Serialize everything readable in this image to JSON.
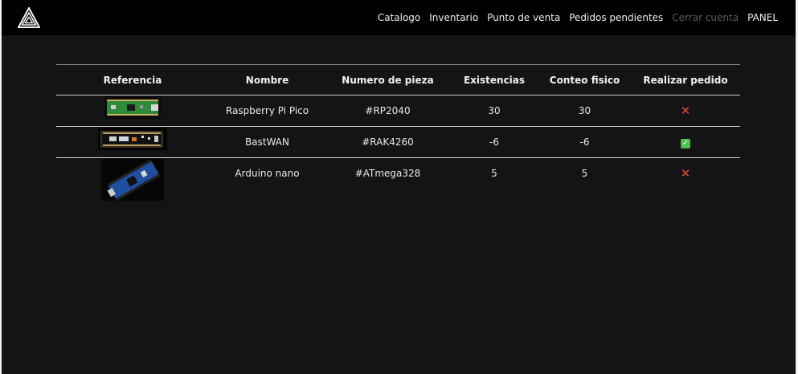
{
  "nav": {
    "items": [
      "Catalogo",
      "Inventario",
      "Punto de venta",
      "Pedidos pendientes"
    ],
    "logout": "Cerrar cuenta",
    "panel": "PANEL"
  },
  "table": {
    "headers": [
      "Referencia",
      "Nombre",
      "Numero de pieza",
      "Existencias",
      "Conteo fisico",
      "Realizar pedido"
    ],
    "rows": [
      {
        "name": "Raspberry Pi Pico",
        "part": "#RP2040",
        "stock": "30",
        "count": "30",
        "order": "x"
      },
      {
        "name": "BastWAN",
        "part": "#RAK4260",
        "stock": "-6",
        "count": "-6",
        "order": "check"
      },
      {
        "name": "Arduino nano",
        "part": "#ATmega328",
        "stock": "5",
        "count": "5",
        "order": "x"
      }
    ]
  },
  "colors": {
    "background": "#141414",
    "navbar": "#000000",
    "cross": "#e5493a",
    "check": "#4cc24a",
    "logout_muted": "#5c5c5c"
  },
  "icons": {
    "logo": "triangle-logo-icon",
    "not_ordered": "x-icon",
    "ordered": "checkbox-checked-icon"
  }
}
